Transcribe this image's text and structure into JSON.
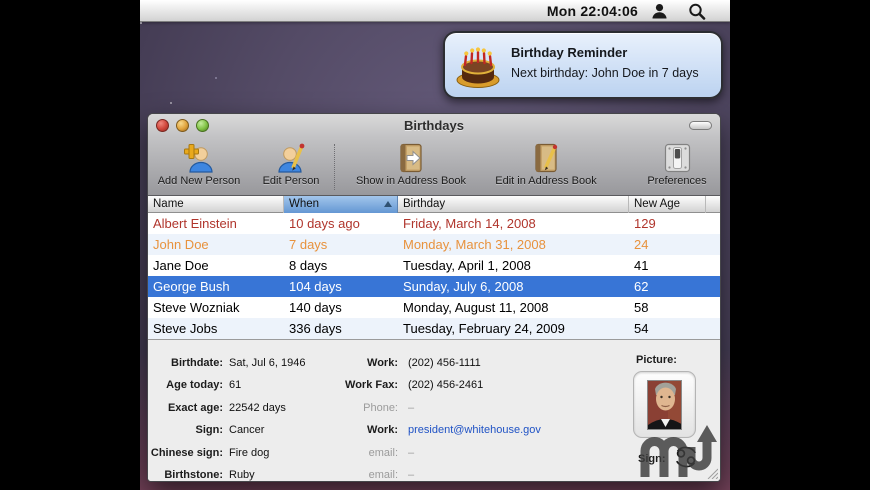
{
  "colors": {
    "selection_blue": "#3875d6",
    "overdue_red": "#b0352c",
    "next_orange": "#e8923d",
    "alt_row_blue": "#edf3fb",
    "link_blue": "#2053c5",
    "notification_blue": "#cfe1f6",
    "desktop_purple": "#544b66"
  },
  "menubar": {
    "clock": "Mon 22:04:06"
  },
  "notification": {
    "title": "Birthday Reminder",
    "message": "Next birthday: John Doe in 7 days"
  },
  "window": {
    "title": "Birthdays",
    "toolbar": {
      "items": [
        {
          "label": "Add New Person",
          "icon": "add-person-icon"
        },
        {
          "label": "Edit Person",
          "icon": "edit-person-icon"
        },
        {
          "label": "Show in Address Book",
          "icon": "show-address-book-icon"
        },
        {
          "label": "Edit in Address Book",
          "icon": "edit-address-book-icon"
        },
        {
          "label": "Preferences",
          "icon": "preferences-switch-icon"
        }
      ]
    },
    "table": {
      "columns": [
        {
          "label": "Name",
          "sorted": false
        },
        {
          "label": "When",
          "sorted": true,
          "sort_direction": "asc"
        },
        {
          "label": "Birthday",
          "sorted": false
        },
        {
          "label": "New Age",
          "sorted": false
        }
      ],
      "rows": [
        {
          "name": "Albert Einstein",
          "when": "10 days ago",
          "birthday": "Friday, March 14, 2008",
          "new_age": "129",
          "state": "overdue"
        },
        {
          "name": "John Doe",
          "when": "7 days",
          "birthday": "Monday, March 31, 2008",
          "new_age": "24",
          "state": "next"
        },
        {
          "name": "Jane Doe",
          "when": "8 days",
          "birthday": "Tuesday, April 1, 2008",
          "new_age": "41",
          "state": "normal"
        },
        {
          "name": "George Bush",
          "when": "104 days",
          "birthday": "Sunday, July 6, 2008",
          "new_age": "62",
          "state": "selected"
        },
        {
          "name": "Steve Wozniak",
          "when": "140 days",
          "birthday": "Monday, August 11, 2008",
          "new_age": "58",
          "state": "normal"
        },
        {
          "name": "Steve Jobs",
          "when": "336 days",
          "birthday": "Tuesday, February 24, 2009",
          "new_age": "54",
          "state": "normal"
        }
      ]
    },
    "details": {
      "left": [
        {
          "label": "Birthdate:",
          "value": "Sat, Jul 6, 1946"
        },
        {
          "label": "Age today:",
          "value": "61"
        },
        {
          "label": "Exact age:",
          "value": "22542 days"
        },
        {
          "label": "Sign:",
          "value": "Cancer"
        },
        {
          "label": "Chinese sign:",
          "value": "Fire dog"
        },
        {
          "label": "Birthstone:",
          "value": "Ruby"
        }
      ],
      "middle": [
        {
          "label": "Work:",
          "value": "(202) 456-1111",
          "style": "normal"
        },
        {
          "label": "Work Fax:",
          "value": "(202) 456-2461",
          "style": "normal"
        },
        {
          "label": "Phone:",
          "value": "–",
          "style": "muted"
        },
        {
          "label": "Work:",
          "value": "president@whitehouse.gov",
          "style": "link"
        },
        {
          "label": "email:",
          "value": "–",
          "style": "muted"
        },
        {
          "label": "email:",
          "value": "–",
          "style": "muted"
        }
      ],
      "picture_label": "Picture:",
      "sign_label": "Sign:",
      "sign_symbol": "Cancer"
    }
  }
}
